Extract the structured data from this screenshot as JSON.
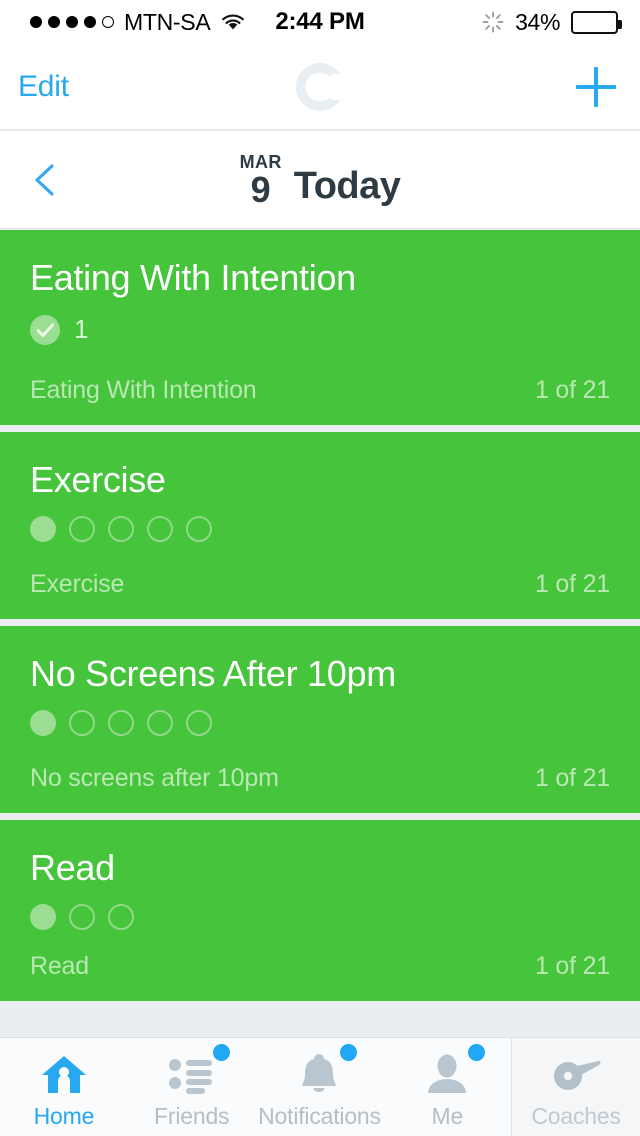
{
  "colors": {
    "card_green": "#45c43c",
    "accent_blue": "#27a9f1",
    "badge_blue": "#21a7f5",
    "battery_yellow": "#f7c60c",
    "page_bg": "#eaeef1",
    "dot_light_green": "#9bdd92",
    "muted_green_text": "#b9e8b2"
  },
  "statusbar": {
    "signal_filled": 4,
    "signal_total": 5,
    "carrier": "MTN-SA",
    "wifi_icon": "wifi-icon",
    "time": "2:44 PM",
    "spinner_icon": "activity-spinner-icon",
    "battery_percent": "34%",
    "battery_level": 34
  },
  "navbar": {
    "edit_label": "Edit",
    "logo_icon": "app-logo-c-icon",
    "add_icon": "plus-icon"
  },
  "datebar": {
    "back_icon": "chevron-left-icon",
    "month": "MAR",
    "day": "9",
    "title": "Today"
  },
  "cards": [
    {
      "title": "Eating With Intention",
      "progress_type": "check",
      "check_icon": "check-circle-icon",
      "check_count": "1",
      "subtitle": "Eating With Intention",
      "count_label": "1 of 21"
    },
    {
      "title": "Exercise",
      "progress_type": "dots",
      "dots_total": 5,
      "dots_filled": 1,
      "subtitle": "Exercise",
      "count_label": "1 of 21"
    },
    {
      "title": "No Screens After 10pm",
      "progress_type": "dots",
      "dots_total": 5,
      "dots_filled": 1,
      "subtitle": "No screens after 10pm",
      "count_label": "1 of 21"
    },
    {
      "title": "Read",
      "progress_type": "dots",
      "dots_total": 3,
      "dots_filled": 1,
      "subtitle": "Read",
      "count_label": "1 of 21"
    }
  ],
  "tabbar": {
    "items": [
      {
        "label": "Home",
        "icon": "home-icon",
        "active": true,
        "badge": false
      },
      {
        "label": "Friends",
        "icon": "friends-list-icon",
        "active": false,
        "badge": true
      },
      {
        "label": "Notifications",
        "icon": "bell-icon",
        "active": false,
        "badge": true
      },
      {
        "label": "Me",
        "icon": "person-icon",
        "active": false,
        "badge": true
      },
      {
        "label": "Coaches",
        "icon": "whistle-icon",
        "active": false,
        "badge": false
      }
    ]
  }
}
